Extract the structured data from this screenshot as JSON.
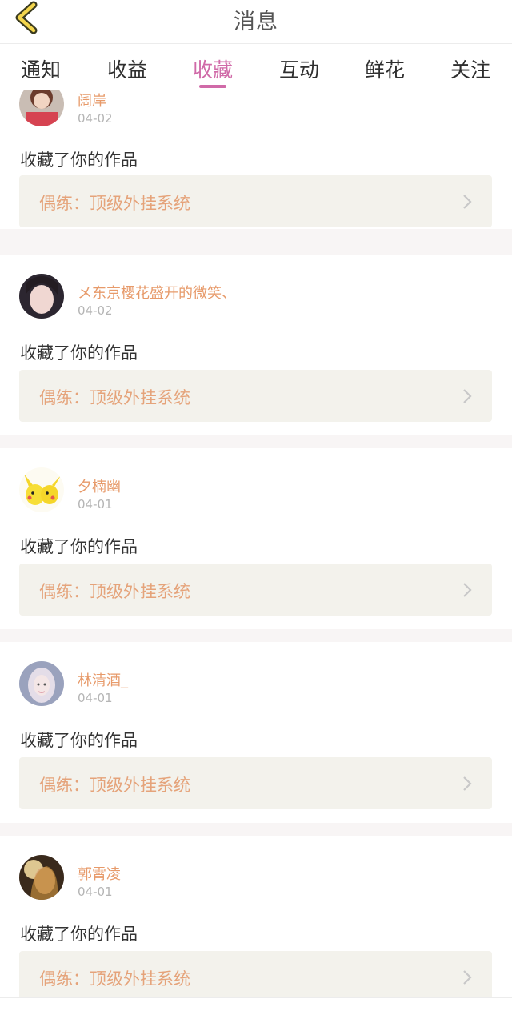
{
  "header": {
    "title": "消息",
    "back_icon": "chevron-left-icon"
  },
  "tabs": [
    {
      "label": "通知"
    },
    {
      "label": "收益"
    },
    {
      "label": "收藏",
      "active": true
    },
    {
      "label": "互动"
    },
    {
      "label": "鲜花"
    },
    {
      "label": "关注"
    }
  ],
  "colors": {
    "accent": "#d06aa8",
    "username": "#e79a6a",
    "work_title": "#e5a37a",
    "work_bg": "#f3f2ec",
    "separator": "#f8f5f5"
  },
  "items": [
    {
      "username": "阔岸",
      "date": "04-02",
      "message": "收藏了你的作品",
      "work_title": "偶练：顶级外挂系统"
    },
    {
      "username": "メ东京樱花盛开的微笑、",
      "date": "04-02",
      "message": "收藏了你的作品",
      "work_title": "偶练：顶级外挂系统"
    },
    {
      "username": "夕楠幽",
      "date": "04-01",
      "message": "收藏了你的作品",
      "work_title": "偶练：顶级外挂系统"
    },
    {
      "username": "林清酒_",
      "date": "04-01",
      "message": "收藏了你的作品",
      "work_title": "偶练：顶级外挂系统"
    },
    {
      "username": "郭霄凌",
      "date": "04-01",
      "message": "收藏了你的作品",
      "work_title": "偶练：顶级外挂系统"
    }
  ]
}
